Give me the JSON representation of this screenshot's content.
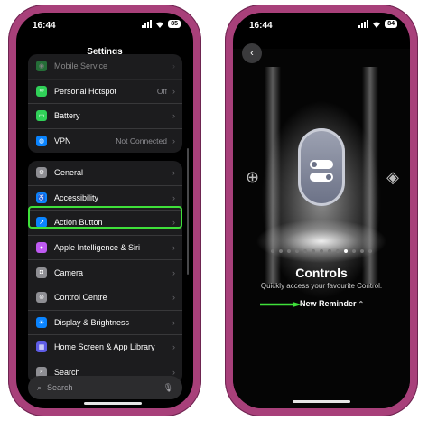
{
  "left_phone": {
    "status": {
      "time": "16:44",
      "battery": "85"
    },
    "title": "Settings",
    "group1": [
      {
        "label": "Mobile Service",
        "value": "",
        "icon": "antenna-icon",
        "color": "#30d158",
        "glyph": "◉"
      },
      {
        "label": "Personal Hotspot",
        "value": "Off",
        "icon": "hotspot-icon",
        "color": "#30d158",
        "glyph": "∞"
      },
      {
        "label": "Battery",
        "value": "",
        "icon": "battery-icon",
        "color": "#30d158",
        "glyph": "▭"
      },
      {
        "label": "VPN",
        "value": "Not Connected",
        "icon": "globe-icon",
        "color": "#0a84ff",
        "glyph": "◍"
      }
    ],
    "group2": [
      {
        "label": "General",
        "icon": "gear-icon",
        "color": "#8e8e93",
        "glyph": "⚙"
      },
      {
        "label": "Accessibility",
        "icon": "accessibility-icon",
        "color": "#0a84ff",
        "glyph": "♿"
      },
      {
        "label": "Action Button",
        "icon": "action-button-icon",
        "color": "#0a84ff",
        "glyph": "↗"
      },
      {
        "label": "Apple Intelligence & Siri",
        "icon": "siri-icon",
        "color": "#bf5af2",
        "glyph": "●"
      },
      {
        "label": "Camera",
        "icon": "camera-icon",
        "color": "#8e8e93",
        "glyph": "◘"
      },
      {
        "label": "Control Centre",
        "icon": "control-centre-icon",
        "color": "#8e8e93",
        "glyph": "⊜"
      },
      {
        "label": "Display & Brightness",
        "icon": "brightness-icon",
        "color": "#0a84ff",
        "glyph": "☀"
      },
      {
        "label": "Home Screen & App Library",
        "icon": "home-screen-icon",
        "color": "#5e5ce6",
        "glyph": "▦"
      },
      {
        "label": "Search",
        "icon": "search-icon",
        "color": "#8e8e93",
        "glyph": "⌕"
      }
    ],
    "search": {
      "placeholder": "Search"
    },
    "highlight_color": "#3fe03a"
  },
  "right_phone": {
    "status": {
      "time": "16:44",
      "battery": "84"
    },
    "control_title": "Controls",
    "control_subtitle": "Quickly access your favourite Control.",
    "selected_control": "New Reminder",
    "page_dots": {
      "count": 13,
      "active_index": 9
    },
    "arrow_color": "#3fe03a"
  }
}
